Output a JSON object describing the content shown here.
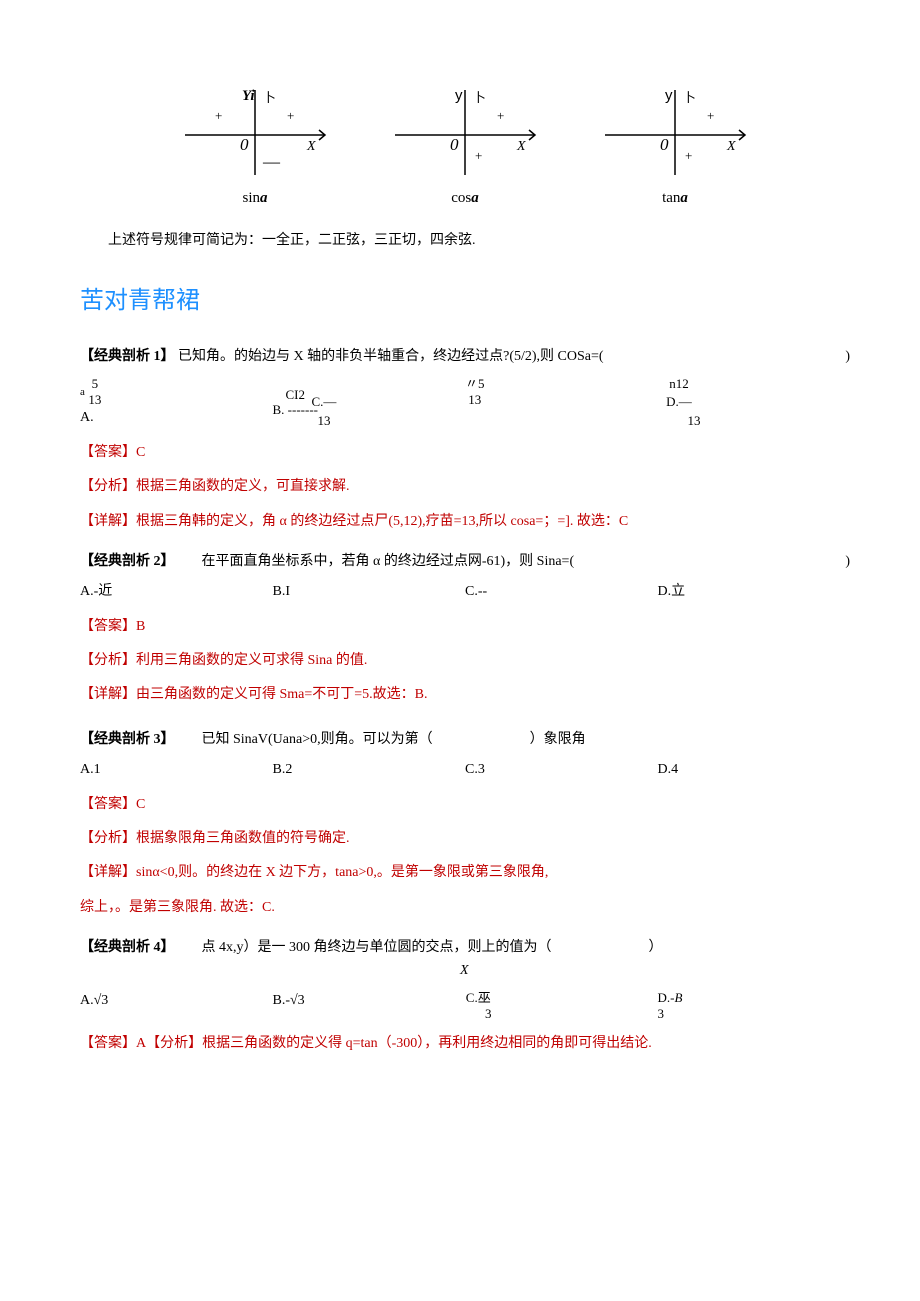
{
  "diagrams": {
    "axis1": {
      "ylabel": "Yi",
      "xlabel": "X",
      "origin": "0",
      "tl": "+",
      "tr": "+",
      "bl": "—",
      "br": "+",
      "haxis": "卜",
      "caption_pre": "sin",
      "caption_var": "a"
    },
    "axis2": {
      "ylabel": "y",
      "xlabel": "X",
      "origin": "0",
      "tl": "+",
      "tr": "+",
      "bl": "+",
      "br": "+",
      "haxis": "卜",
      "caption_pre": "cos",
      "caption_var": "a"
    },
    "axis3": {
      "ylabel": "y",
      "xlabel": "X",
      "origin": "0",
      "tl": "+",
      "tr": "+",
      "bl": "+",
      "br": "+",
      "haxis": "卜",
      "caption_pre": "tan",
      "caption_var": "a"
    }
  },
  "rule": "上述符号规律可简记为：一全正，二正弦，三正切，四余弦.",
  "section_title": "苦对青帮裙",
  "p1": {
    "title": "【经典剖析 1】",
    "stem": "已知角。的始边与 X 轴的非负半轴重合，终边经过点?(5/2),则 COSa=(",
    "close": ")",
    "optA_pre": "a",
    "optA_main": "A.",
    "optA_top": "5",
    "optA_bot": "13",
    "optB_main": "B. -------",
    "optB_top": "CI2",
    "optB_bot": "13",
    "optC_main": "C.—",
    "optC_top": "〃5",
    "optC_bot": "13",
    "optD_main": "D.—",
    "optD_top": "n12",
    "optD_bot": "13",
    "answer_label": "【答案】",
    "answer": "C",
    "analysis_label": "【分析】",
    "analysis": "根据三角函数的定义，可直接求解.",
    "detail_label": "【详解】",
    "detail": "根据三角韩的定义，角 α 的终边经过点尸(5,12),疗苗=13,所以 cosa=；=]. 故选：C"
  },
  "p2": {
    "title": "【经典剖析 2】",
    "stem": "在平面直角坐标系中，若角 α 的终边经过点网-61)，则 Sina=(",
    "close": ")",
    "optA": "A.-近",
    "optB": "B.I",
    "optC": "C.--",
    "optD": "D.立",
    "answer_label": "【答案】",
    "answer": "B",
    "analysis_label": "【分析】",
    "analysis": "利用三角函数的定义可求得 Sina 的值.",
    "detail_label": "【详解】",
    "detail": "由三角函数的定义可得 Sma=不可丁=5.故选：B."
  },
  "p3": {
    "title": "【经典剖析 3】",
    "stem": "已知 SinaV(Uana>0,则角。可以为第（",
    "close": "）象限角",
    "optA": "A.1",
    "optB": "B.2",
    "optC": "C.3",
    "optD": "D.4",
    "answer_label": "【答案】",
    "answer": "C",
    "analysis_label": "【分析】",
    "analysis": "根据象限角三角函数值的符号确定.",
    "detail_label": "【详解】",
    "detail": "sinα<0,则。的终边在 X 边下方，tana>0,。是第一象限或第三象限角,",
    "detail2": "综上，。是第三象限角. 故选：C."
  },
  "p4": {
    "title": "【经典剖析 4】",
    "stem_pre": "点 4x,y）是一 300 角终边与单位圆的交点，则上的值为（",
    "stem_sub": "X",
    "close": "）",
    "optA": "A.√3",
    "optB": "B.-√3",
    "optC_main": "C.巫",
    "optC_bot": "3",
    "optD_main": "D.-",
    "optD_bot": "3",
    "optD_var": "B",
    "answer_label": "【答案】",
    "answer": "A",
    "analysis_label": "【分析】",
    "analysis": "根据三角函数的定义得 q=tan（-300），再利用终边相同的角即可得出结论."
  }
}
